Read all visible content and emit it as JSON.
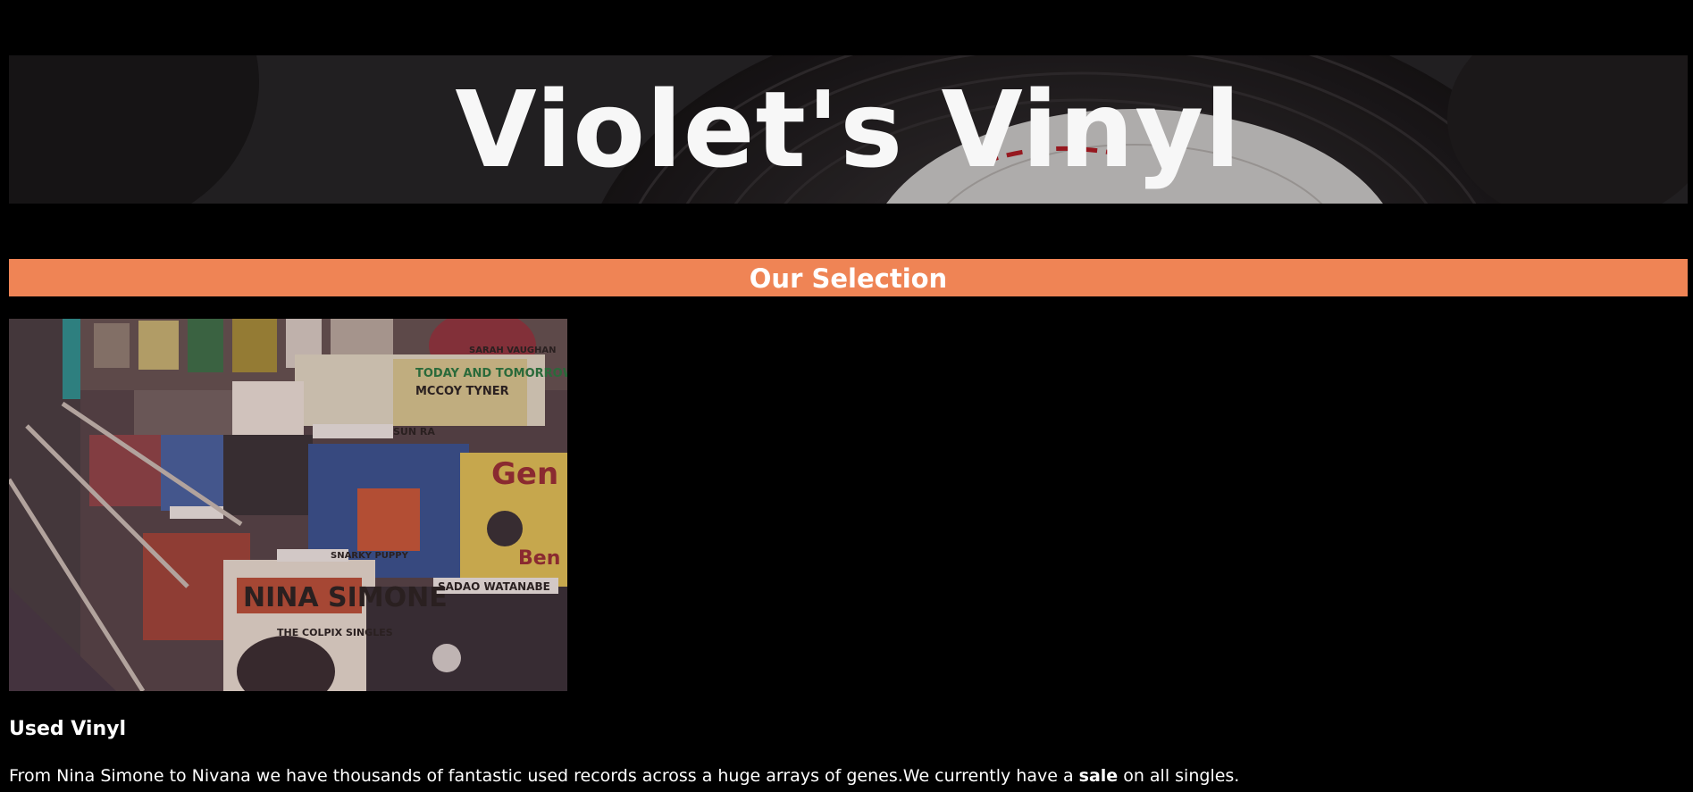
{
  "header": {
    "title": "Violet's Vinyl",
    "background_image": "vinyl-record-closeup"
  },
  "section": {
    "heading": "Our Selection",
    "accent_color": "#ef8455"
  },
  "product": {
    "image": "record-store-bins",
    "title": "Used Vinyl",
    "description_before": "From Nina Simone to Nivana we have thousands of fantastic used records across a huge arrays of genes.We currently have a ",
    "description_bold": "sale",
    "description_after": " on all singles.",
    "album_labels": [
      "NINA SIMONE",
      "THE COLPIX SINGLES",
      "TODAY AND TOMORROW",
      "MCCOY TYNER",
      "SUN RA",
      "SARAH VAUGHAN",
      "SNARKY PUPPY",
      "SADAO WATANABE",
      "Gen",
      "Ben"
    ]
  }
}
